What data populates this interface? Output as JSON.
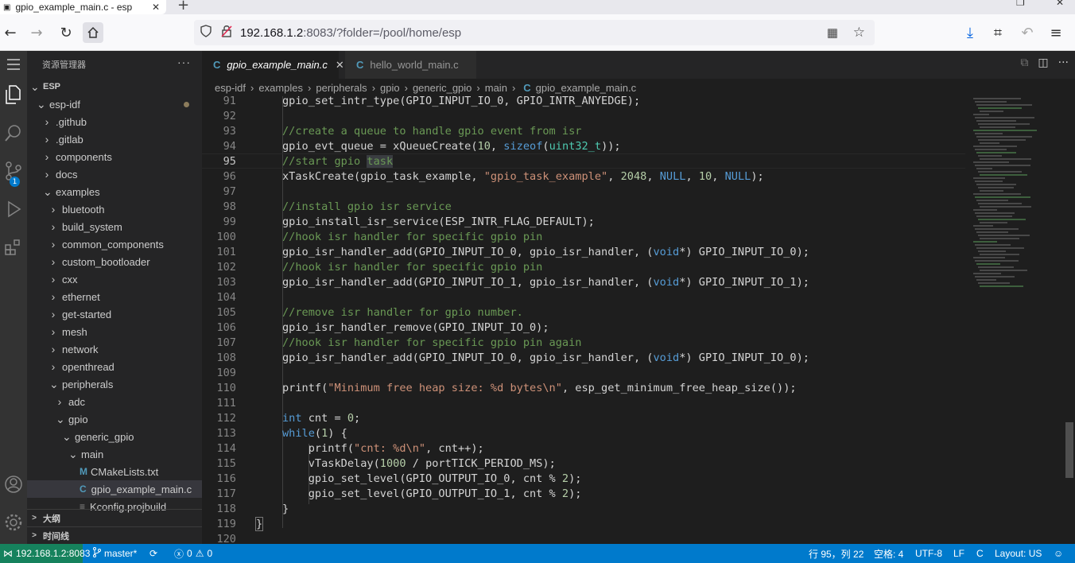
{
  "browser": {
    "tab_title": "gpio_example_main.c - esp",
    "url_host": "192.168.1.2",
    "url_path": ":8083/?folder=/pool/home/esp"
  },
  "sidebar": {
    "title": "资源管理器",
    "more": "···",
    "tree": [
      {
        "label": "ESP",
        "depth": 0,
        "chev": "v",
        "bold": true
      },
      {
        "label": "esp-idf",
        "depth": 1,
        "chev": "v",
        "modified": true
      },
      {
        "label": ".github",
        "depth": 2,
        "chev": ">"
      },
      {
        "label": ".gitlab",
        "depth": 2,
        "chev": ">"
      },
      {
        "label": "components",
        "depth": 2,
        "chev": ">"
      },
      {
        "label": "docs",
        "depth": 2,
        "chev": ">"
      },
      {
        "label": "examples",
        "depth": 2,
        "chev": "v"
      },
      {
        "label": "bluetooth",
        "depth": 3,
        "chev": ">"
      },
      {
        "label": "build_system",
        "depth": 3,
        "chev": ">"
      },
      {
        "label": "common_components",
        "depth": 3,
        "chev": ">"
      },
      {
        "label": "custom_bootloader",
        "depth": 3,
        "chev": ">"
      },
      {
        "label": "cxx",
        "depth": 3,
        "chev": ">"
      },
      {
        "label": "ethernet",
        "depth": 3,
        "chev": ">"
      },
      {
        "label": "get-started",
        "depth": 3,
        "chev": ">"
      },
      {
        "label": "mesh",
        "depth": 3,
        "chev": ">"
      },
      {
        "label": "network",
        "depth": 3,
        "chev": ">"
      },
      {
        "label": "openthread",
        "depth": 3,
        "chev": ">"
      },
      {
        "label": "peripherals",
        "depth": 3,
        "chev": "v"
      },
      {
        "label": "adc",
        "depth": 4,
        "chev": ">"
      },
      {
        "label": "gpio",
        "depth": 4,
        "chev": "v"
      },
      {
        "label": "generic_gpio",
        "depth": 5,
        "chev": "v"
      },
      {
        "label": "main",
        "depth": 6,
        "chev": "v"
      },
      {
        "label": "CMakeLists.txt",
        "depth": 7,
        "icon": "M"
      },
      {
        "label": "gpio_example_main.c",
        "depth": 7,
        "icon": "C",
        "selected": true
      },
      {
        "label": "Kconfig.projbuild",
        "depth": 7,
        "icon": "≡"
      }
    ],
    "sections": [
      "大纲",
      "时间线"
    ]
  },
  "editor": {
    "tabs": [
      {
        "label": "gpio_example_main.c",
        "active": true
      },
      {
        "label": "hello_world_main.c",
        "active": false
      }
    ],
    "breadcrumb": [
      "esp-idf",
      "examples",
      "peripherals",
      "gpio",
      "generic_gpio",
      "main",
      "gpio_example_main.c"
    ],
    "current_line": 95,
    "lines": [
      {
        "n": 91,
        "code": "gpio_set_intr_type(GPIO_INPUT_IO_0, GPIO_INTR_ANYEDGE);"
      },
      {
        "n": 92,
        "code": ""
      },
      {
        "n": 93,
        "code": "//create a queue to handle gpio event from isr"
      },
      {
        "n": 94,
        "code": "gpio_evt_queue = xQueueCreate(10, sizeof(uint32_t));"
      },
      {
        "n": 95,
        "code": "//start gpio task"
      },
      {
        "n": 96,
        "code": "xTaskCreate(gpio_task_example, \"gpio_task_example\", 2048, NULL, 10, NULL);"
      },
      {
        "n": 97,
        "code": ""
      },
      {
        "n": 98,
        "code": "//install gpio isr service"
      },
      {
        "n": 99,
        "code": "gpio_install_isr_service(ESP_INTR_FLAG_DEFAULT);"
      },
      {
        "n": 100,
        "code": "//hook isr handler for specific gpio pin"
      },
      {
        "n": 101,
        "code": "gpio_isr_handler_add(GPIO_INPUT_IO_0, gpio_isr_handler, (void*) GPIO_INPUT_IO_0);"
      },
      {
        "n": 102,
        "code": "//hook isr handler for specific gpio pin"
      },
      {
        "n": 103,
        "code": "gpio_isr_handler_add(GPIO_INPUT_IO_1, gpio_isr_handler, (void*) GPIO_INPUT_IO_1);"
      },
      {
        "n": 104,
        "code": ""
      },
      {
        "n": 105,
        "code": "//remove isr handler for gpio number."
      },
      {
        "n": 106,
        "code": "gpio_isr_handler_remove(GPIO_INPUT_IO_0);"
      },
      {
        "n": 107,
        "code": "//hook isr handler for specific gpio pin again"
      },
      {
        "n": 108,
        "code": "gpio_isr_handler_add(GPIO_INPUT_IO_0, gpio_isr_handler, (void*) GPIO_INPUT_IO_0);"
      },
      {
        "n": 109,
        "code": ""
      },
      {
        "n": 110,
        "code": "printf(\"Minimum free heap size: %d bytes\\n\", esp_get_minimum_free_heap_size());"
      },
      {
        "n": 111,
        "code": ""
      },
      {
        "n": 112,
        "code": "int cnt = 0;"
      },
      {
        "n": 113,
        "code": "while(1) {"
      },
      {
        "n": 114,
        "code": "    printf(\"cnt: %d\\n\", cnt++);"
      },
      {
        "n": 115,
        "code": "    vTaskDelay(1000 / portTICK_PERIOD_MS);"
      },
      {
        "n": 116,
        "code": "    gpio_set_level(GPIO_OUTPUT_IO_0, cnt % 2);"
      },
      {
        "n": 117,
        "code": "    gpio_set_level(GPIO_OUTPUT_IO_1, cnt % 2);"
      },
      {
        "n": 118,
        "code": "}"
      },
      {
        "n": 119,
        "code": "}"
      },
      {
        "n": 120,
        "code": ""
      }
    ]
  },
  "statusbar": {
    "remote": "192.168.1.2:8083",
    "branch": "master*",
    "errors": "0",
    "warnings": "0",
    "position": "行 95，列 22",
    "spaces": "空格: 4",
    "encoding": "UTF-8",
    "eol": "LF",
    "language": "C",
    "layout": "Layout: US"
  },
  "activity_badge": "1",
  "colors": {
    "accent": "#007acc",
    "remote": "#16825d"
  }
}
